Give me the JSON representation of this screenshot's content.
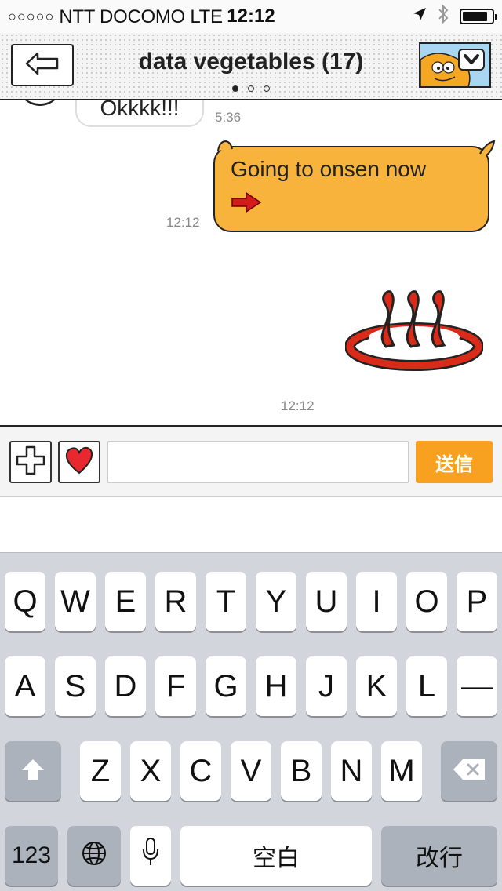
{
  "status_bar": {
    "signal_dots": "○○○○○",
    "carrier": "NTT DOCOMO",
    "network": "LTE",
    "time": "12:12",
    "icons": [
      "location-arrow-icon",
      "bluetooth-icon",
      "battery-icon"
    ],
    "battery_level": 0.85
  },
  "nav": {
    "title": "data vegetables (17)",
    "page_count": 3,
    "active_page": 1
  },
  "messages": [
    {
      "side": "left",
      "text": "Okkkk!!!",
      "time": "5:36"
    },
    {
      "side": "right",
      "text": "Going to onsen now",
      "time": "12:12",
      "icon": "right-arrow-emoji-icon"
    },
    {
      "side": "right",
      "type": "sticker",
      "icon": "hot-spring-icon",
      "time": "12:12"
    }
  ],
  "toolbar": {
    "plus_icon": "plus-icon",
    "heart_icon": "heart-icon",
    "input_value": "",
    "send_label": "送信"
  },
  "keyboard": {
    "row1": [
      "Q",
      "W",
      "E",
      "R",
      "T",
      "Y",
      "U",
      "I",
      "O",
      "P"
    ],
    "row2": [
      "A",
      "S",
      "D",
      "F",
      "G",
      "H",
      "J",
      "K",
      "L",
      "—"
    ],
    "row3": [
      "Z",
      "X",
      "C",
      "V",
      "B",
      "N",
      "M"
    ],
    "numbers_label": "123",
    "space_label": "空白",
    "return_label": "改行"
  },
  "colors": {
    "accent": "#f7b33c",
    "send": "#f8a020",
    "onsen_red": "#d92b1a"
  }
}
